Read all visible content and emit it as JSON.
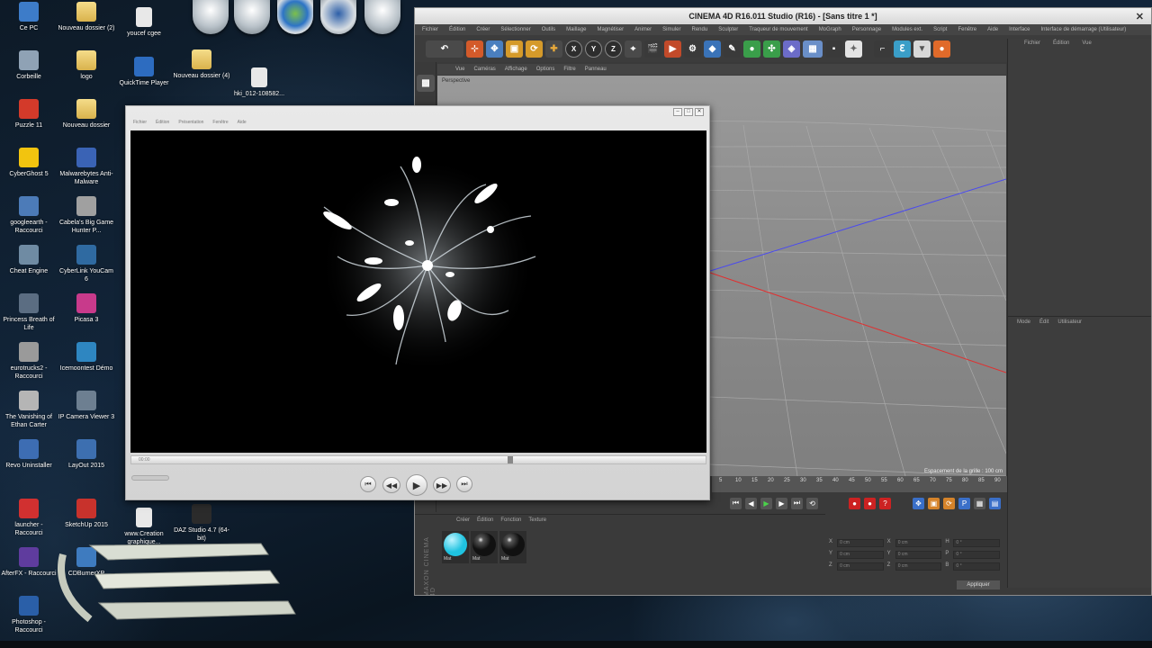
{
  "desktop": {
    "col1": [
      {
        "label": "Ce PC",
        "icon": "computer-icon",
        "color": "#3d7cc9"
      },
      {
        "label": "Corbeille",
        "icon": "recycle-bin-icon",
        "color": "#8fa2b5"
      },
      {
        "label": "Puzzle 11",
        "icon": "puzzle-app-icon",
        "color": "#d33a2a"
      },
      {
        "label": "CyberGhost 5",
        "icon": "cyberghost-icon",
        "color": "#f2c40f"
      },
      {
        "label": "googleearth - Raccourci",
        "icon": "google-earth-icon",
        "color": "#4c7bb8"
      },
      {
        "label": "Cheat Engine",
        "icon": "cheat-engine-icon",
        "color": "#6f8ba3"
      },
      {
        "label": "Princess Breath of Life",
        "icon": "game-icon",
        "color": "#5b6d82"
      },
      {
        "label": "eurotrucks2 - Raccourci",
        "icon": "truck-game-icon",
        "color": "#9a9a9a"
      },
      {
        "label": "The Vanishing of Ethan Carter",
        "icon": "game-icon",
        "color": "#b5b5b5"
      },
      {
        "label": "Revo Uninstaller",
        "icon": "uninstaller-icon",
        "color": "#3d6db3"
      },
      {
        "label": "launcher - Raccourci",
        "icon": "launcher-icon",
        "color": "#d13030"
      },
      {
        "label": "AfterFX - Raccourci",
        "icon": "after-effects-icon",
        "color": "#5f3c9e"
      },
      {
        "label": "Photoshop - Raccourci",
        "icon": "photoshop-icon",
        "color": "#2a5fa8"
      }
    ],
    "col2": [
      {
        "label": "Nouveau dossier (2)",
        "icon": "folder-icon"
      },
      {
        "label": "logo",
        "icon": "folder-icon"
      },
      {
        "label": "Nouveau dossier",
        "icon": "folder-icon"
      },
      {
        "label": "Malwarebytes Anti-Malware",
        "icon": "malwarebytes-icon",
        "color": "#3a63b5"
      },
      {
        "label": "Cabela's Big Game Hunter P...",
        "icon": "game-icon",
        "color": "#a0a0a0"
      },
      {
        "label": "CyberLink YouCam 6",
        "icon": "youcam-icon",
        "color": "#2f6aa1"
      },
      {
        "label": "Picasa 3",
        "icon": "picasa-icon",
        "color": "#c83a8b"
      },
      {
        "label": "Icemoontest Démo",
        "icon": "game-icon",
        "color": "#2e86c1"
      },
      {
        "label": "IP Camera Viewer 3",
        "icon": "camera-icon",
        "color": "#6d7f91"
      },
      {
        "label": "LayOut 2015",
        "icon": "layout-icon",
        "color": "#3d6fb0"
      },
      {
        "label": "SketchUp 2015",
        "icon": "sketchup-icon",
        "color": "#c8322c"
      },
      {
        "label": "CDBurnerXP",
        "icon": "cd-burner-icon",
        "color": "#3e7bbf"
      }
    ],
    "col3": [
      {
        "label": "youcef cgee",
        "icon": "document-icon"
      },
      {
        "label": "QuickTime Player",
        "icon": "quicktime-icon",
        "color": "#2d6cc0"
      },
      {
        "label": "www.Creation graphique...",
        "icon": "document-icon"
      }
    ],
    "col4": [
      {
        "label": "Nouveau dossier (4)",
        "icon": "folder-icon"
      },
      {
        "label": "DAZ Studio 4.7 (64-bit)",
        "icon": "daz-studio-icon",
        "color": "#2b2b2b"
      }
    ],
    "col5": [
      {
        "label": "hki_012-108582...",
        "icon": "image-file-icon"
      }
    ],
    "orbs": [
      "taskbar-orb-icon",
      "taskbar-orb-icon",
      "windows-orb-icon",
      "computer-orb-icon",
      "clock-orb-icon"
    ]
  },
  "c4d": {
    "title": "CINEMA 4D R16.011 Studio (R16) - [Sans titre 1 *]",
    "menu": [
      "Fichier",
      "Édition",
      "Créer",
      "Sélectionner",
      "Outils",
      "Maillage",
      "Magnétiser",
      "Animer",
      "Simuler",
      "Rendu",
      "Sculpter",
      "Traqueur de mouvement",
      "MoGraph",
      "Personnage",
      "Modules ext.",
      "Script",
      "Fenêtre",
      "Aide",
      "Interface",
      "Interface de démarrage (Utilisateur)"
    ],
    "viewport_menu": [
      "Vue",
      "Caméras",
      "Affichage",
      "Options",
      "Filtre",
      "Panneau"
    ],
    "viewport_label": "Perspective",
    "grid_label": "Espacement de la grille : 100 cm",
    "right_tabs": [
      "Fichier",
      "Édition",
      "Vue"
    ],
    "right_tabs2": [
      "Mode",
      "Édit",
      "Utilisateur"
    ],
    "timeline_ticks": [
      "5",
      "10",
      "15",
      "20",
      "25",
      "30",
      "35",
      "40",
      "45",
      "50",
      "55",
      "60",
      "65",
      "70",
      "75",
      "80",
      "85",
      "90"
    ],
    "mat_tabs": [
      "Créer",
      "Édition",
      "Fonction",
      "Texture"
    ],
    "maxon": "MAXON CINEMA 4D",
    "materials": [
      {
        "label": "Mat",
        "color": "#1fc3e0"
      },
      {
        "label": "Mat",
        "color": "#111111"
      },
      {
        "label": "Mat",
        "color": "#111111"
      }
    ],
    "attr_axes": [
      "X",
      "Y",
      "Z",
      "X",
      "Y",
      "Z",
      "H",
      "P",
      "B"
    ],
    "attr_values": [
      "0 cm",
      "0 cm",
      "0 cm",
      "0 cm",
      "0 cm",
      "0 cm",
      "0 °",
      "0 °",
      "0 °"
    ],
    "apply_label": "Appliquer"
  },
  "quicktime": {
    "title_hint": "",
    "menu": [
      "Fichier",
      "Édition",
      "Présentation",
      "Fenêtre",
      "Aide"
    ],
    "time": "00:00",
    "progress": 0.66,
    "controls": [
      "previous",
      "rewind",
      "play",
      "fast-forward",
      "next"
    ]
  }
}
